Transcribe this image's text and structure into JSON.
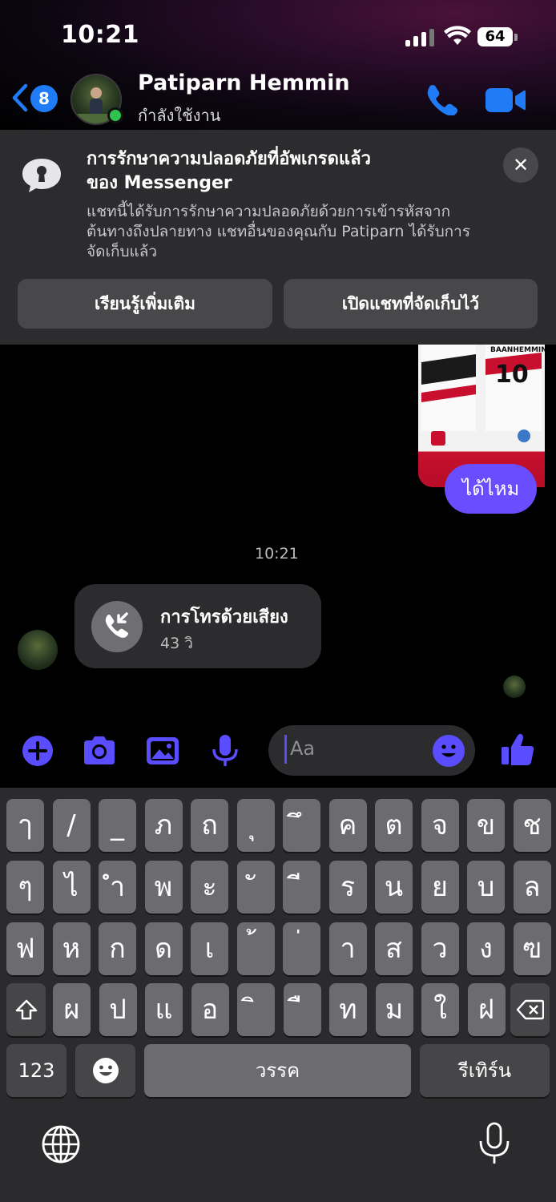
{
  "status_bar": {
    "time": "10:21",
    "battery": "64"
  },
  "header": {
    "back_count": "8",
    "contact_name": "Patiparn Hemmin",
    "contact_status": "กำลังใช้งาน"
  },
  "notice": {
    "title_line1": "การรักษาความปลอดภัยที่อัพเกรดแล้ว",
    "title_line2": "ของ Messenger",
    "body_line1": "แชทนี้ได้รับการรักษาความปลอดภัยด้วยการเข้ารหัสจาก",
    "body_line2": "ต้นทางถึงปลายทาง แชทอื่นของคุณกับ Patiparn ได้รับการ",
    "body_line3": "จัดเก็บแล้ว",
    "learn_more": "เรียนรู้เพิ่มเติม",
    "open_archived": "เปิดแชทที่จัดเก็บไว้",
    "close": "✕"
  },
  "chat": {
    "jersey_number": "10",
    "jersey_brand": "BAANHEMMIN",
    "outgoing_message": "ได้ไหม",
    "timestamp": "10:21",
    "call_title": "การโทรด้วยเสียง",
    "call_duration": "43 วิ"
  },
  "composer": {
    "placeholder": "Aa"
  },
  "keyboard": {
    "row1": [
      "ๅ",
      "/",
      "_",
      "ภ",
      "ถ",
      "ุ",
      "ึ",
      "ค",
      "ต",
      "จ",
      "ข",
      "ช"
    ],
    "row2": [
      "ๆ",
      "ไ",
      "ำ",
      "พ",
      "ะ",
      "ั",
      "ี",
      "ร",
      "น",
      "ย",
      "บ",
      "ล"
    ],
    "row3": [
      "ฟ",
      "ห",
      "ก",
      "ด",
      "เ",
      "้",
      "่",
      "า",
      "ส",
      "ว",
      "ง",
      "ฃ"
    ],
    "row4": [
      "ผ",
      "ป",
      "แ",
      "อ",
      "ิ",
      "ื",
      "ท",
      "ม",
      "ใ",
      "ฝ"
    ],
    "numbers": "123",
    "space": "วรรค",
    "return": "รีเทิร์น"
  },
  "colors": {
    "accent": "#6a4dff",
    "call_blue": "#1f7cf6",
    "online": "#31c24d"
  }
}
